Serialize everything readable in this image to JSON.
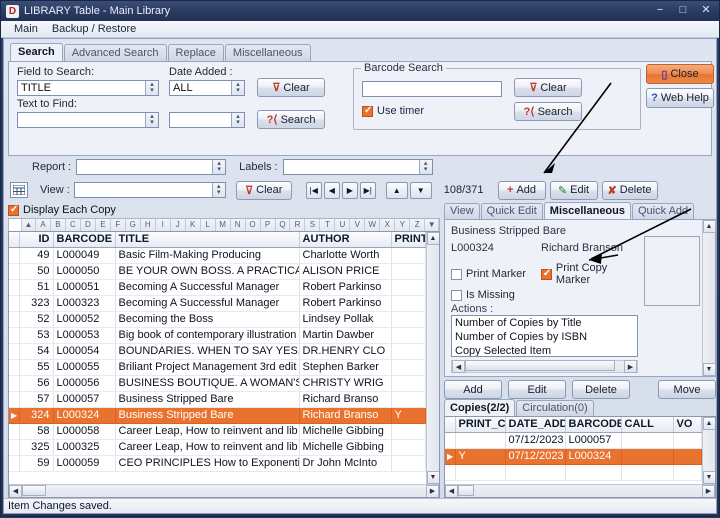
{
  "window": {
    "title": "LIBRARY Table - Main Library",
    "icon_letter": "D",
    "minimize": "−",
    "maximize": "□",
    "close": "✕"
  },
  "menubar": {
    "items": [
      "Main",
      "Backup / Restore"
    ]
  },
  "tabs": {
    "items": [
      "Search",
      "Advanced Search",
      "Replace",
      "Miscellaneous"
    ],
    "active": "Search"
  },
  "search": {
    "field_to_search_label": "Field to Search:",
    "field_to_search_value": "TITLE",
    "text_to_find_label": "Text to Find:",
    "text_to_find_value": "",
    "date_added_label": "Date Added :",
    "date_added_value": "ALL",
    "date_second_value": "",
    "clear_label": "Clear",
    "search_label": "Search"
  },
  "barcode": {
    "group_label": "Barcode Search",
    "value": "",
    "use_timer_label": "Use timer",
    "use_timer_checked": true,
    "clear_label": "Clear",
    "search_label": "Search"
  },
  "header_buttons": {
    "close_label": "Close",
    "web_help_label": "Web Help",
    "close_color": "#ef8a4c"
  },
  "report_row": {
    "report_label": "Report :",
    "report_value": "",
    "labels_label": "Labels :",
    "labels_value": ""
  },
  "view_row": {
    "view_label": "View :",
    "view_value": "",
    "clear_label": "Clear",
    "record_counter": "108/371",
    "add_label": "Add",
    "edit_label": "Edit",
    "delete_label": "Delete",
    "nav_first": "|◀",
    "nav_prev": "◀",
    "nav_next": "▶",
    "nav_last": "▶|",
    "nav_up": "▲",
    "nav_down": "▼"
  },
  "display_each_copy": {
    "label": "Display Each Copy",
    "checked": true
  },
  "alphabet_bar": {
    "letters": [
      "A",
      "B",
      "C",
      "D",
      "E",
      "F",
      "G",
      "H",
      "I",
      "J",
      "K",
      "L",
      "M",
      "N",
      "O",
      "P",
      "Q",
      "R",
      "S",
      "T",
      "U",
      "V",
      "W",
      "X",
      "Y",
      "Z"
    ],
    "left_arrow": "▲",
    "right_arrow": "▼"
  },
  "main_table": {
    "columns": [
      "ID",
      "BARCODE",
      "TITLE",
      "AUTHOR",
      "PRINT_I"
    ],
    "rows": [
      {
        "id": "49",
        "barcode": "L000049",
        "title": "Basic Film-Making Producing",
        "author": "Charlotte Worth",
        "print": "",
        "selected": false
      },
      {
        "id": "50",
        "barcode": "L000050",
        "title": "BE YOUR OWN BOSS. A PRACTICA",
        "author": "ALISON PRICE",
        "print": "",
        "selected": false
      },
      {
        "id": "51",
        "barcode": "L000051",
        "title": "Becoming A Successful Manager",
        "author": "Robert Parkinso",
        "print": "",
        "selected": false
      },
      {
        "id": "323",
        "barcode": "L000323",
        "title": "Becoming A Successful Manager",
        "author": "Robert Parkinso",
        "print": "",
        "selected": false
      },
      {
        "id": "52",
        "barcode": "L000052",
        "title": "Becoming the Boss",
        "author": "Lindsey Pollak",
        "print": "",
        "selected": false
      },
      {
        "id": "53",
        "barcode": "L000053",
        "title": "Big book of contemporary illustration",
        "author": "Martin Dawber",
        "print": "",
        "selected": false
      },
      {
        "id": "54",
        "barcode": "L000054",
        "title": "BOUNDARIES. WHEN TO SAY YES,",
        "author": "DR.HENRY CLO",
        "print": "",
        "selected": false
      },
      {
        "id": "55",
        "barcode": "L000055",
        "title": "Briliant Project Management 3rd edit",
        "author": "Stephen Barker",
        "print": "",
        "selected": false
      },
      {
        "id": "56",
        "barcode": "L000056",
        "title": "BUSINESS BOUTIQUE. A WOMAN'S",
        "author": "CHRISTY WRIG",
        "print": "",
        "selected": false
      },
      {
        "id": "57",
        "barcode": "L000057",
        "title": "Business Stripped Bare",
        "author": "Richard Branso",
        "print": "",
        "selected": false
      },
      {
        "id": "324",
        "barcode": "L000324",
        "title": "Business Stripped Bare",
        "author": "Richard Branso",
        "print": "Y",
        "selected": true
      },
      {
        "id": "58",
        "barcode": "L000058",
        "title": "Career Leap, How to reinvent and lib",
        "author": "Michelle Gibbing",
        "print": "",
        "selected": false
      },
      {
        "id": "325",
        "barcode": "L000325",
        "title": "Career Leap, How to reinvent and lib",
        "author": "Michelle Gibbing",
        "print": "",
        "selected": false
      },
      {
        "id": "59",
        "barcode": "L000059",
        "title": "CEO PRINCIPLES How to Exponentia",
        "author": "Dr John McInto",
        "print": "",
        "selected": false
      }
    ]
  },
  "detail_tabs": {
    "items": [
      "View",
      "Quick Edit",
      "Miscellaneous",
      "Quick Add"
    ],
    "active": "Miscellaneous"
  },
  "miscellaneous": {
    "item_title": "Business Stripped Bare",
    "item_barcode": "L000324",
    "item_author": "Richard Branson",
    "print_marker_label": "Print Marker",
    "print_marker_checked": false,
    "print_copy_marker_label": "Print Copy Marker",
    "print_copy_marker_checked": true,
    "is_missing_label": "Is Missing",
    "is_missing_checked": false,
    "actions_label": "Actions :",
    "actions": [
      "Number of Copies by Title",
      "Number of Copies by ISBN",
      "Copy Selected Item"
    ]
  },
  "copy_buttons": {
    "add_label": "Add",
    "edit_label": "Edit",
    "delete_label": "Delete",
    "move_label": "Move"
  },
  "copy_tabs": {
    "items": [
      "Copies(2/2)",
      "Circulation(0)"
    ],
    "active": "Copies(2/2)"
  },
  "copies_table": {
    "columns": [
      "PRINT_C",
      "DATE_ADDI",
      "BARCODE",
      "CALL",
      "VO"
    ],
    "rows": [
      {
        "print_c": "",
        "date_added": "07/12/2023",
        "barcode": "L000057",
        "call": "",
        "vo": "",
        "selected": false
      },
      {
        "print_c": "Y",
        "date_added": "07/12/2023",
        "barcode": "L000324",
        "call": "",
        "vo": "",
        "selected": true
      }
    ]
  },
  "statusbar": {
    "message": "Item Changes saved."
  },
  "colors": {
    "selection": "#e8722e",
    "titlebar": "#2d3f66",
    "accent_button": "#ef8a4c",
    "panel": "#eef1f7"
  }
}
